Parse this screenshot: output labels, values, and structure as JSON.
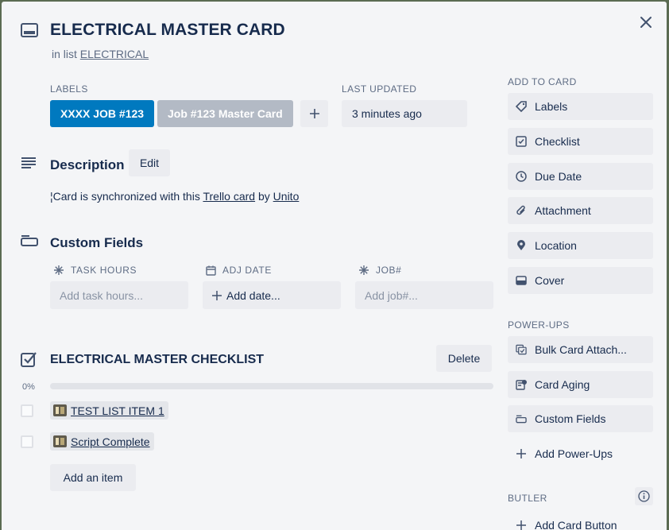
{
  "card": {
    "title": "ELECTRICAL MASTER CARD",
    "in_list_prefix": "in list",
    "list_name": "ELECTRICAL"
  },
  "labels": {
    "heading": "LABELS",
    "items": [
      {
        "text": "XXXX JOB #123",
        "color": "#0079bf"
      },
      {
        "text": "Job #123 Master Card",
        "color": "#b3bac5"
      }
    ],
    "add": "+"
  },
  "last_updated": {
    "heading": "LAST UPDATED",
    "value": "3 minutes ago"
  },
  "description": {
    "heading": "Description",
    "edit_label": "Edit",
    "prefix": "¦Card is synchronized with this",
    "link1": "Trello card",
    "mid": "by",
    "link2": "Unito"
  },
  "custom_fields": {
    "heading": "Custom Fields",
    "fields": [
      {
        "label": "TASK HOURS",
        "placeholder": "Add task hours...",
        "icon": "hash-icon"
      },
      {
        "label": "ADJ DATE",
        "placeholder": "Add date...",
        "icon": "calendar-icon"
      },
      {
        "label": "JOB#",
        "placeholder": "Add job#...",
        "icon": "hash-icon"
      }
    ]
  },
  "checklist": {
    "heading": "ELECTRICAL MASTER CHECKLIST",
    "delete_label": "Delete",
    "progress": "0%",
    "progress_value": 0,
    "items": [
      "TEST LIST ITEM 1",
      "Script Complete"
    ],
    "add_item": "Add an item"
  },
  "sidebar": {
    "add_to_card_heading": "ADD TO CARD",
    "add_to_card": [
      {
        "label": "Labels",
        "icon": "tag-icon"
      },
      {
        "label": "Checklist",
        "icon": "checklist-icon"
      },
      {
        "label": "Due Date",
        "icon": "clock-icon"
      },
      {
        "label": "Attachment",
        "icon": "paperclip-icon"
      },
      {
        "label": "Location",
        "icon": "location-pin-icon"
      },
      {
        "label": "Cover",
        "icon": "cover-icon"
      }
    ],
    "powerups_heading": "POWER-UPS",
    "powerups": [
      {
        "label": "Bulk Card Attach...",
        "icon": "bulk-attach-icon"
      },
      {
        "label": "Card Aging",
        "icon": "card-aging-icon"
      },
      {
        "label": "Custom Fields",
        "icon": "custom-fields-icon"
      },
      {
        "label": "Add Power-Ups",
        "icon": "plus-icon"
      }
    ],
    "butler_heading": "BUTLER",
    "butler_add": "Add Card Button"
  }
}
